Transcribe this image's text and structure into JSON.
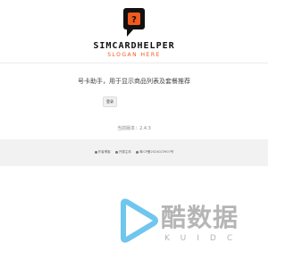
{
  "header": {
    "brand_name": "SIMCARDHELPER",
    "slogan": "SLOGAN HERE",
    "logo_icon": "chat-bubble-icon",
    "accent_color": "#f25a1d"
  },
  "main": {
    "description": "号卡助手，用于显示商品列表及套餐推荐",
    "login_label": "登录",
    "version_text": "当前版本：2.4.3"
  },
  "footer": {
    "links": [
      "作者博客",
      "开源主体",
      "粤ICP备2024023907号"
    ]
  },
  "watermark": {
    "brand_cn": "酷数据",
    "brand_en": "KUIDC"
  }
}
